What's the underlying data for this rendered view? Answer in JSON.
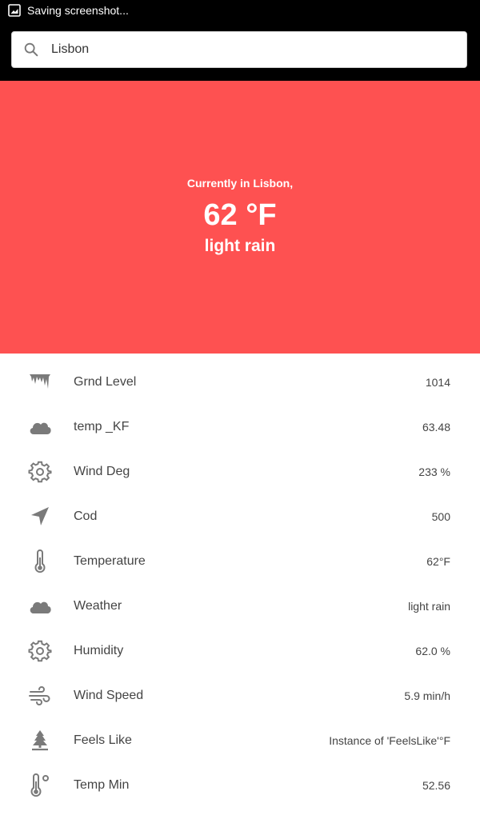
{
  "status_bar": {
    "notification": "Saving screenshot..."
  },
  "search": {
    "value": "Lisbon"
  },
  "hero": {
    "currently": "Currently in Lisbon,",
    "temperature": "62 °F",
    "description": "light rain",
    "background": "#fe5151"
  },
  "rows": [
    {
      "icon": "icicle-icon",
      "label": "Grnd Level",
      "value": "1014"
    },
    {
      "icon": "cloud-icon",
      "label": "temp _KF",
      "value": "63.48"
    },
    {
      "icon": "gear-icon",
      "label": "Wind Deg",
      "value": "233 %"
    },
    {
      "icon": "navigation-arrow-icon",
      "label": "Cod",
      "value": "500"
    },
    {
      "icon": "thermometer-icon",
      "label": "Temperature",
      "value": "62°F"
    },
    {
      "icon": "cloud-icon",
      "label": "Weather",
      "value": "light rain"
    },
    {
      "icon": "gear-icon",
      "label": "Humidity",
      "value": "62.0 %"
    },
    {
      "icon": "wind-icon",
      "label": "Wind Speed",
      "value": "5.9 min/h"
    },
    {
      "icon": "tree-icon",
      "label": "Feels Like",
      "value": "Instance of 'FeelsLike'°F"
    },
    {
      "icon": "thermometer-degree-icon",
      "label": "Temp Min",
      "value": "52.56"
    }
  ]
}
